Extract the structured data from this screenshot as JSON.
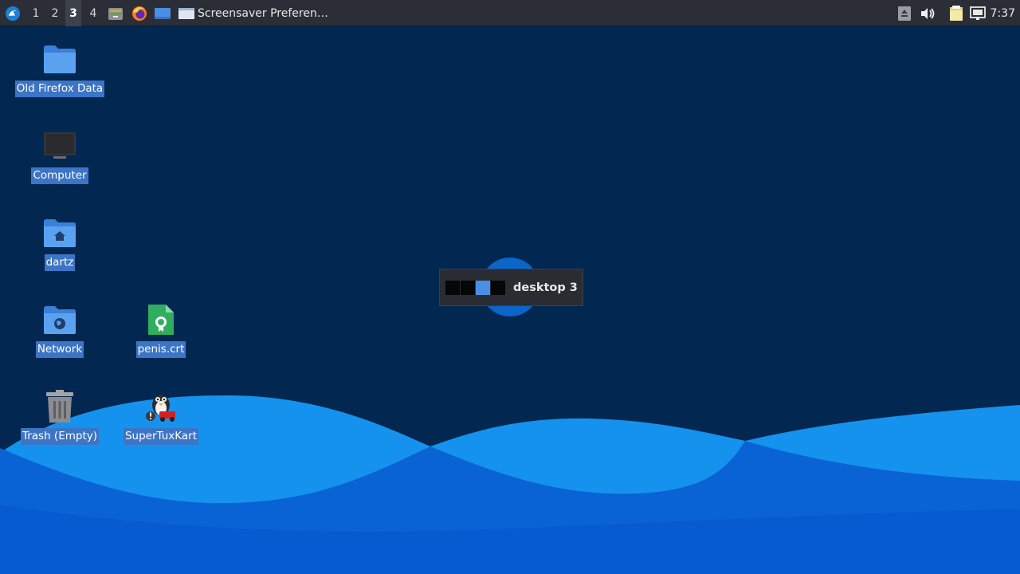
{
  "panel": {
    "workspaces": [
      "1",
      "2",
      "3",
      "4"
    ],
    "active_workspace": "3",
    "launchers": [
      "file-manager-icon",
      "firefox-icon",
      "desktop-icon"
    ],
    "task_title": "Screensaver Preferen…",
    "clock": "7:37"
  },
  "desktop": {
    "icons": [
      {
        "label": "Old Firefox Data",
        "icon": "folder-icon"
      },
      {
        "label": "Computer",
        "icon": "computer-icon"
      },
      {
        "label": "dartz",
        "icon": "home-folder-icon"
      },
      {
        "label": "Network",
        "icon": "network-folder-icon"
      },
      {
        "label": "penis.crt",
        "icon": "certificate-icon"
      },
      {
        "label": "Trash (Empty)",
        "icon": "trash-icon"
      },
      {
        "label": "SuperTuxKart",
        "icon": "supertuxkart-icon"
      }
    ]
  },
  "osd": {
    "label": "desktop 3",
    "workspace_count": 4,
    "current_index": 3
  },
  "colors": {
    "panel": "#2b2e37",
    "desktop_bg": "#022750",
    "selection": "#3c74c6",
    "wave_light": "#1592ee",
    "wave_dark": "#0a63d4"
  }
}
